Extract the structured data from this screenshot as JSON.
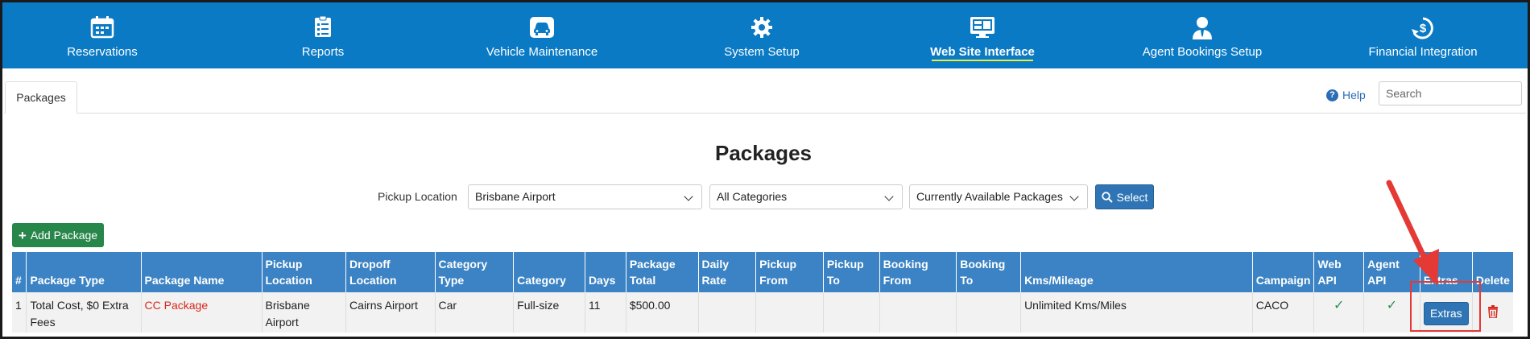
{
  "nav": {
    "items": [
      {
        "label": "Reservations",
        "icon": "calendar-icon"
      },
      {
        "label": "Reports",
        "icon": "report-list-icon"
      },
      {
        "label": "Vehicle Maintenance",
        "icon": "car-icon"
      },
      {
        "label": "System Setup",
        "icon": "gear-icon"
      },
      {
        "label": "Web Site Interface",
        "icon": "monitor-icon",
        "active": true
      },
      {
        "label": "Agent Bookings Setup",
        "icon": "agent-icon"
      },
      {
        "label": "Financial Integration",
        "icon": "dollar-sync-icon"
      }
    ]
  },
  "tabs": {
    "active": "Packages"
  },
  "help": {
    "label": "Help"
  },
  "search": {
    "placeholder": "Search"
  },
  "page": {
    "title": "Packages"
  },
  "filters": {
    "pickup_label": "Pickup Location",
    "pickup_value": "Brisbane Airport",
    "category_value": "All Categories",
    "availability_value": "Currently Available Packages",
    "select_label": "Select"
  },
  "add_button": {
    "label": "Add Package"
  },
  "table": {
    "headers": [
      "#",
      "Package Type",
      "Package Name",
      "Pickup Location",
      "Dropoff Location",
      "Category Type",
      "Category",
      "Days",
      "Package Total",
      "Daily Rate",
      "Pickup From",
      "Pickup To",
      "Booking From",
      "Booking To",
      "Kms/Mileage",
      "Campaign",
      "Web API",
      "Agent API",
      "Extras",
      "Delete"
    ],
    "rows": [
      {
        "num": "1",
        "package_type": "Total Cost, $0 Extra Fees",
        "package_name": "CC Package",
        "pickup_location": "Brisbane Airport",
        "dropoff_location": "Cairns Airport",
        "category_type": "Car",
        "category": "Full-size",
        "days": "11",
        "package_total": "$500.00",
        "daily_rate": "",
        "pickup_from": "",
        "pickup_to": "",
        "booking_from": "",
        "booking_to": "",
        "kms": "Unlimited Kms/Miles",
        "campaign": "CACO",
        "web_api": "✓",
        "agent_api": "✓",
        "extras_label": "Extras"
      }
    ]
  },
  "colors": {
    "nav_bg": "#0a7ac4",
    "header_bg": "#3b83c4",
    "add_green": "#27864a",
    "link_red": "#d9281b",
    "annotation_red": "#e53935"
  }
}
